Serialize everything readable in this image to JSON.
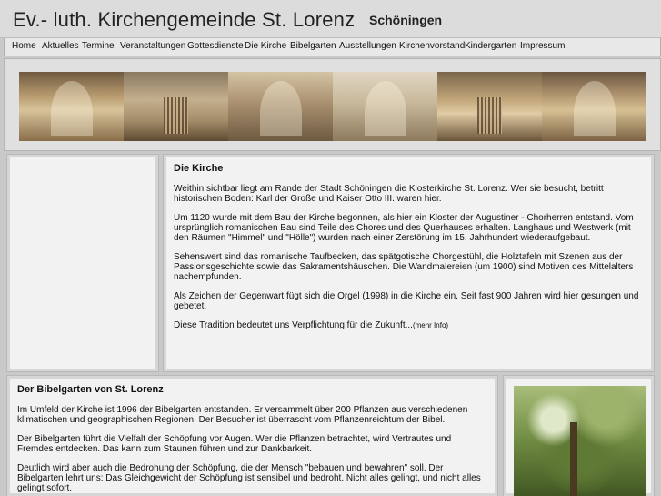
{
  "header": {
    "title": "Ev.- luth. Kirchengemeinde St. Lorenz",
    "city": "Schöningen"
  },
  "nav": {
    "items": [
      {
        "label": "Home"
      },
      {
        "label": "Aktuelles"
      },
      {
        "label": "Termine"
      },
      {
        "label": "Veranstaltungen"
      },
      {
        "label": "Gottesdienste"
      },
      {
        "label": "Die Kirche"
      },
      {
        "label": "Bibelgarten"
      },
      {
        "label": "Ausstellungen"
      },
      {
        "label": "Kirchenvorstand"
      },
      {
        "label": "Kindergarten"
      },
      {
        "label": "Impressum"
      }
    ]
  },
  "church": {
    "heading": "Die Kirche",
    "p1": "Weithin sichtbar liegt am Rande der Stadt Schöningen die Klosterkirche St. Lorenz. Wer sie besucht, betritt historischen Boden: Karl der Große und Kaiser Otto III. waren hier.",
    "p2": "Um 1120 wurde mit dem Bau der Kirche begonnen, als hier ein Kloster der Augustiner - Chorherren entstand. Vom ursprünglich romanischen Bau sind Teile des Chores und des Querhauses erhalten. Langhaus und Westwerk (mit den Räumen \"Himmel\" und \"Hölle\") wurden nach einer Zerstörung im 15. Jahrhundert wiederaufgebaut.",
    "p3": "Sehenswert sind das romanische Taufbecken, das spätgotische Chorgestühl, die Holztafeln mit Szenen aus der Passionsgeschichte sowie das Sakramentshäuschen. Die Wandmalereien (um 1900) sind Motiven des Mittelalters nachempfunden.",
    "p4": "Als Zeichen der Gegenwart fügt sich die Orgel (1998) in die Kirche ein. Seit fast 900 Jahren wird hier gesungen und gebetet.",
    "p5": "Diese Tradition bedeutet uns Verpflichtung für die Zukunft...",
    "more": "(mehr Info)"
  },
  "garden": {
    "heading": "Der Bibelgarten von St. Lorenz",
    "p1": "Im Umfeld der Kirche ist 1996 der Bibelgarten entstanden. Er versammelt über 200 Pflanzen aus verschiedenen klimatischen und geographischen Regionen. Der Besucher ist überrascht vom Pflanzenreichtum der Bibel.",
    "p2": "Der Bibelgarten führt die Vielfalt der Schöpfung vor Augen. Wer die Pflanzen betrachtet, wird Vertrautes und Fremdes entdecken. Das kann zum Staunen führen und zur Dankbarkeit.",
    "p3": "Deutlich wird aber auch die Bedrohung der Schöpfung, die der Mensch \"bebauen und bewahren\" soll. Der Bibelgarten lehrt uns: Das Gleichgewicht der Schöpfung ist sensibel und bedroht. Nicht alles gelingt, und nicht alles gelingt sofort."
  }
}
